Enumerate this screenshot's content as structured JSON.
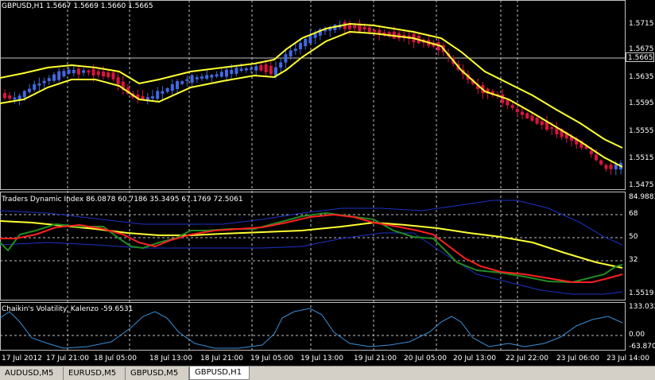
{
  "main_pane": {
    "label": "GBPUSD,H1  1.5667 1.5669 1.5660 1.5665",
    "price_ticks": [
      "1.5715",
      "1.5675",
      "1.5635",
      "1.5595",
      "1.5555",
      "1.5515",
      "1.5475"
    ],
    "current_price": "1.5665"
  },
  "tdi_pane": {
    "label": "Traders Dynamic Index 86.0878 60.7186 35.3495 67.1769 72.5061",
    "scale_ticks": [
      "84.9883",
      "68",
      "50",
      "32",
      "1.5519"
    ]
  },
  "chaikin_pane": {
    "label": "Chaikin's Volatility_Kalenzo -59.6531",
    "scale_ticks": [
      "133.032",
      "0.00",
      "-63.8706"
    ]
  },
  "time_axis": [
    "17 Jul 2012",
    "17 Jul 21:00",
    "18 Jul 05:00",
    "18 Jul 13:00",
    "18 Jul 21:00",
    "19 Jul 05:00",
    "19 Jul 13:00",
    "19 Jul 21:00",
    "20 Jul 05:00",
    "20 Jul 13:00",
    "22 Jul 22:00",
    "23 Jul 06:00",
    "23 Jul 14:00"
  ],
  "tabs": [
    {
      "label": "AUDUSD,M5",
      "active": false
    },
    {
      "label": "EURUSD,M5",
      "active": false
    },
    {
      "label": "GBPUSD,M5",
      "active": false
    },
    {
      "label": "GBPUSD,H1",
      "active": true
    }
  ],
  "colors": {
    "bull": "#4169e1",
    "bear": "#dc143c",
    "envelope": "#ffff33",
    "tdi_green": "#228b22",
    "tdi_red": "#ff2020",
    "tdi_blue": "#1e32c8",
    "chaikin": "#3a8fd8"
  }
}
